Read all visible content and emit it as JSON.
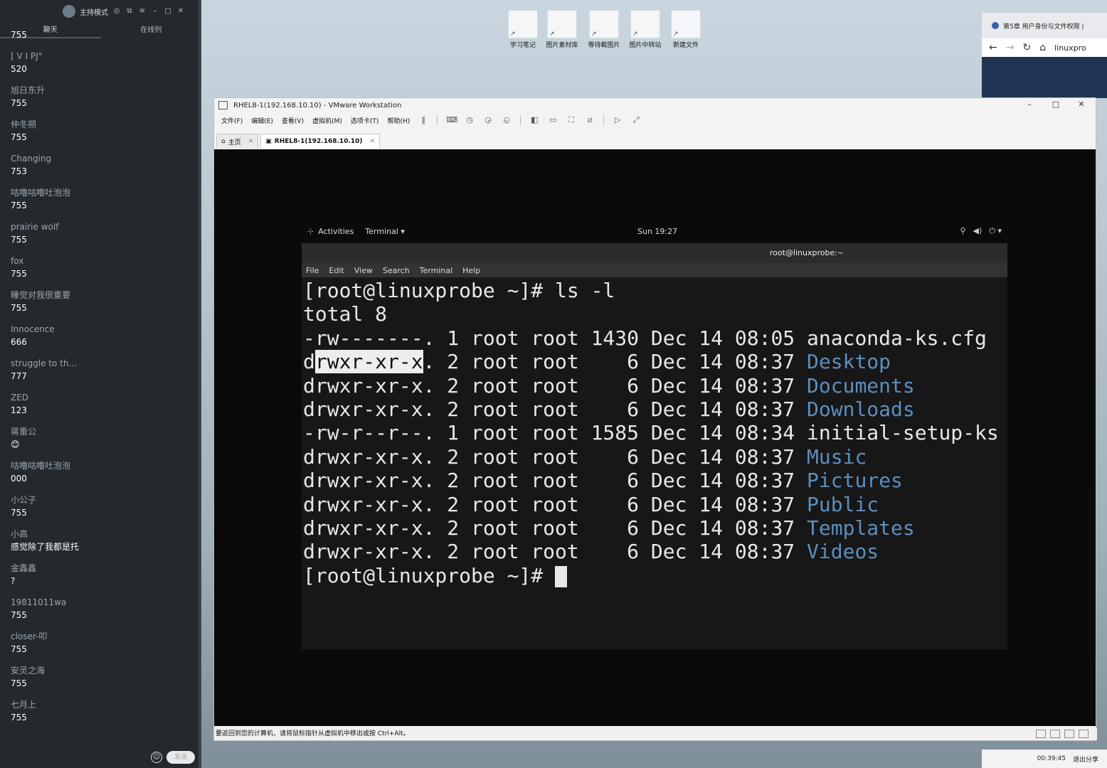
{
  "chat": {
    "host_mode": "主持模式",
    "tabs": [
      "聊天",
      "在线列"
    ],
    "messages": [
      {
        "name": "",
        "text": "755"
      },
      {
        "name": "[ V I PJ°",
        "text": "520"
      },
      {
        "name": "旭日东升",
        "text": "755"
      },
      {
        "name": "仲冬朔",
        "text": "755"
      },
      {
        "name": "Changing",
        "text": "753"
      },
      {
        "name": "咕噜咕噜吐泡泡",
        "text": "755"
      },
      {
        "name": "prairie wolf",
        "text": "755"
      },
      {
        "name": "fox",
        "text": "755"
      },
      {
        "name": "睡觉对我很重要",
        "text": "755"
      },
      {
        "name": "Innocence",
        "text": "666"
      },
      {
        "name": "struggle to th...",
        "text": "777"
      },
      {
        "name": "ZED",
        "text": "123"
      },
      {
        "name": "蒋重公",
        "text": "😊"
      },
      {
        "name": "咕噜咕噜吐泡泡",
        "text": "000"
      },
      {
        "name": "小公子",
        "text": "755"
      },
      {
        "name": "小高",
        "text": "感觉除了我都是托"
      },
      {
        "name": "金鑫鑫",
        "text": "?"
      },
      {
        "name": "19811011wa",
        "text": "755"
      },
      {
        "name": "closer-叩",
        "text": "755"
      },
      {
        "name": "安灵之海",
        "text": "755"
      },
      {
        "name": "七月上",
        "text": "755"
      }
    ],
    "send_label": "发送"
  },
  "desktop_icons": [
    "学习笔记",
    "图片素材库",
    "等待截图片",
    "图片中转站",
    "新建文件"
  ],
  "browser": {
    "tab_title": "第5章 用户身份与文件权限 |",
    "url": "linuxpro"
  },
  "vmware": {
    "title": "RHEL8-1(192.168.10.10) - VMware Workstation",
    "menu": [
      "文件(F)",
      "编辑(E)",
      "查看(V)",
      "虚拟机(M)",
      "选项卡(T)",
      "帮助(H)"
    ],
    "tabs": [
      {
        "label": "主页"
      },
      {
        "label": "RHEL8-1(192.168.10.10)"
      }
    ],
    "status": "要返回到您的计算机，请将鼠标指针从虚拟机中移出或按 Ctrl+Alt。"
  },
  "gnome": {
    "activities": "Activities",
    "app_menu": "Terminal ▾",
    "clock": "Sun 19:27"
  },
  "terminal": {
    "title": "root@linuxprobe:~",
    "menu": [
      "File",
      "Edit",
      "View",
      "Search",
      "Terminal",
      "Help"
    ],
    "prompt_cmd": "[root@linuxprobe ~]# ls -l",
    "total": "total 8",
    "rows": [
      {
        "pre": "-rw-------. 1 root root 1430 Dec 14 08:05 ",
        "name": "anaconda-ks.cfg",
        "dir": false
      },
      {
        "pre": ". 2 root root    6 Dec 14 08:37 ",
        "name": "Desktop",
        "dir": true,
        "hl_d": "d",
        "hl": "rwxr-xr-x"
      },
      {
        "pre": "drwxr-xr-x. 2 root root    6 Dec 14 08:37 ",
        "name": "Documents",
        "dir": true
      },
      {
        "pre": "drwxr-xr-x. 2 root root    6 Dec 14 08:37 ",
        "name": "Downloads",
        "dir": true
      },
      {
        "pre": "-rw-r--r--. 1 root root 1585 Dec 14 08:34 ",
        "name": "initial-setup-ks",
        "dir": false
      },
      {
        "pre": "drwxr-xr-x. 2 root root    6 Dec 14 08:37 ",
        "name": "Music",
        "dir": true
      },
      {
        "pre": "drwxr-xr-x. 2 root root    6 Dec 14 08:37 ",
        "name": "Pictures",
        "dir": true
      },
      {
        "pre": "drwxr-xr-x. 2 root root    6 Dec 14 08:37 ",
        "name": "Public",
        "dir": true
      },
      {
        "pre": "drwxr-xr-x. 2 root root    6 Dec 14 08:37 ",
        "name": "Templates",
        "dir": true
      },
      {
        "pre": "drwxr-xr-x. 2 root root    6 Dec 14 08:37 ",
        "name": "Videos",
        "dir": true
      }
    ],
    "prompt": "[root@linuxprobe ~]# "
  },
  "taskbar": {
    "timer": "00:39:45",
    "leave": "退出分享"
  }
}
